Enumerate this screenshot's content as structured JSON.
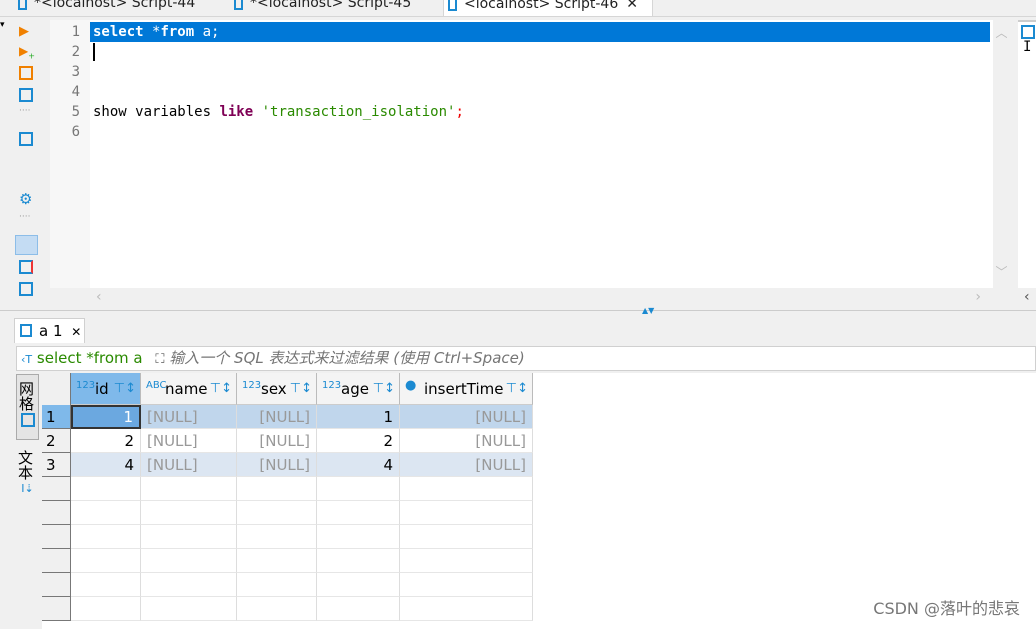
{
  "tabs": [
    {
      "label": "*<localhost> Script-44"
    },
    {
      "label": "*<localhost> Script-45"
    },
    {
      "label": "<localhost> Script-46",
      "active": true
    }
  ],
  "editor": {
    "line_numbers": [
      "1",
      "2",
      "3",
      "4",
      "5",
      "6"
    ],
    "line1": {
      "kw1": "select",
      "t1": " *",
      "kw2": "from",
      "t2": " a;"
    },
    "line5": {
      "t1": "show variables ",
      "kw": "like",
      "sp": " ",
      "str": "'transaction_isolation'",
      "end": ";"
    }
  },
  "right_panel": {
    "text": "I"
  },
  "results": {
    "tab_label": "a 1",
    "filter_query": "select *from a",
    "filter_placeholder": "输入一个 SQL 表达式来过滤结果 (使用 Ctrl+Space)",
    "side_tabs": {
      "grid": "网格",
      "text": "文本"
    },
    "columns": [
      {
        "name": "id",
        "type": "123"
      },
      {
        "name": "name",
        "type": "ABC"
      },
      {
        "name": "sex",
        "type": "123"
      },
      {
        "name": "age",
        "type": "123"
      },
      {
        "name": "insertTime",
        "type": "clock"
      }
    ],
    "rows": [
      {
        "num": "1",
        "cells": [
          "1",
          "[NULL]",
          "[NULL]",
          "1",
          "[NULL]"
        ]
      },
      {
        "num": "2",
        "cells": [
          "2",
          "[NULL]",
          "[NULL]",
          "2",
          "[NULL]"
        ]
      },
      {
        "num": "3",
        "cells": [
          "4",
          "[NULL]",
          "[NULL]",
          "4",
          "[NULL]"
        ]
      }
    ]
  },
  "colors": {
    "selection": "#0078d7",
    "row_selected": "#c0d6ec",
    "row_alt": "#dce6f2",
    "accent": "#1b8ad1"
  },
  "watermark": "CSDN @落叶的悲哀"
}
